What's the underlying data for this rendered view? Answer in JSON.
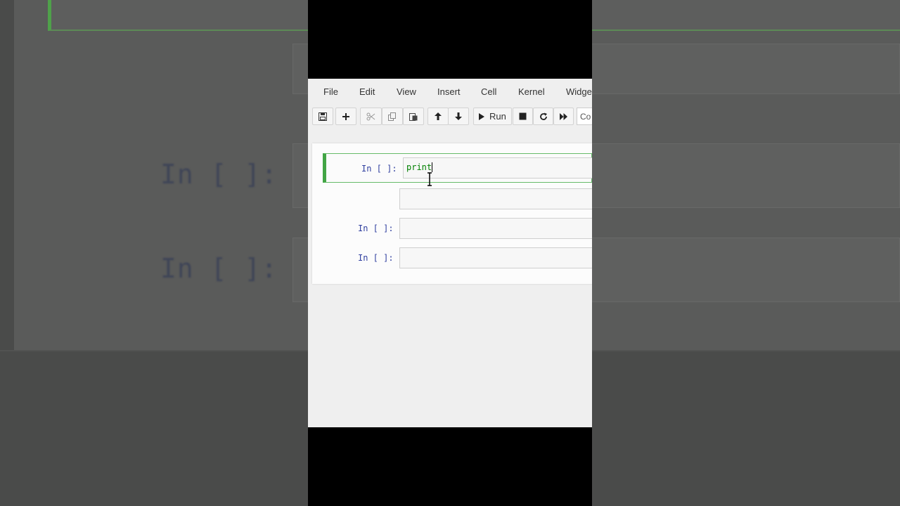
{
  "menubar": {
    "items": [
      "File",
      "Edit",
      "View",
      "Insert",
      "Cell",
      "Kernel",
      "Widge"
    ]
  },
  "toolbar": {
    "buttons": [
      {
        "name": "save",
        "icon": "floppy-disk-icon"
      },
      {
        "name": "insert-cell-below",
        "icon": "plus-icon"
      },
      {
        "name": "cut",
        "icon": "scissors-icon"
      },
      {
        "name": "copy",
        "icon": "copy-icon"
      },
      {
        "name": "paste",
        "icon": "paste-icon"
      },
      {
        "name": "move-up",
        "icon": "arrow-up-icon"
      },
      {
        "name": "move-down",
        "icon": "arrow-down-icon"
      },
      {
        "name": "run",
        "icon": "play-icon",
        "label": "Run"
      },
      {
        "name": "interrupt",
        "icon": "stop-icon"
      },
      {
        "name": "restart",
        "icon": "refresh-icon"
      },
      {
        "name": "restart-run-all",
        "icon": "fast-forward-icon"
      }
    ],
    "cell_type_value": "Co"
  },
  "cells": [
    {
      "prompt": "In [ ]:",
      "code": "print",
      "selected": true
    },
    {
      "prompt": "",
      "code": "",
      "selected": false
    },
    {
      "prompt": "In [ ]:",
      "code": "",
      "selected": false
    },
    {
      "prompt": "In [ ]:",
      "code": "",
      "selected": false
    }
  ],
  "background": {
    "prompts": [
      "In [ ]:",
      "In [ ]:"
    ]
  },
  "colors": {
    "selected_border": "#42a545",
    "prompt": "#303f9f",
    "keyword": "#008000"
  }
}
